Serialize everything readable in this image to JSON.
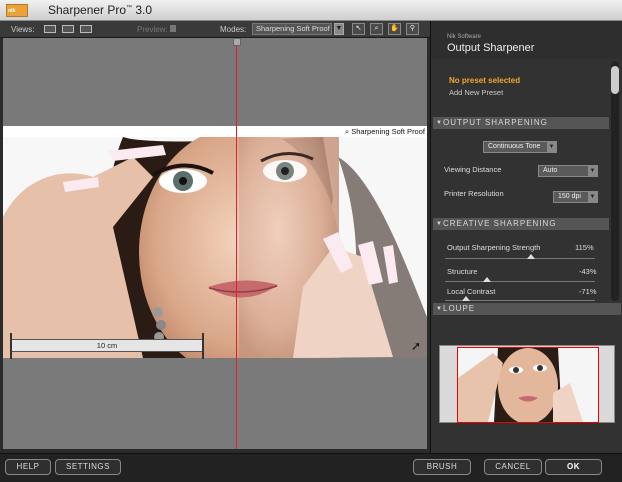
{
  "window": {
    "title": "Sharpener Pro",
    "title_sup": "™",
    "version": " 3.0",
    "logo_text": "nik"
  },
  "toolbar": {
    "views_label": "Views:",
    "preview_label": "Preview:",
    "modes_label": "Modes:",
    "mode_value": "Sharpening Soft Proof",
    "tools": [
      "pointer-tool",
      "zoom-tool",
      "hand-tool",
      "eyedropper-tool"
    ]
  },
  "canvas": {
    "soft_proof_label": "Sharpening Soft Proof",
    "ruler_label": "10 cm"
  },
  "panel": {
    "vendor": "Nik Software",
    "title": "Output Sharpener",
    "preset_status": "No preset selected",
    "add_preset": "Add New Preset",
    "output_section": "OUTPUT SHARPENING",
    "output_type": "Continuous Tone",
    "viewing_distance_label": "Viewing Distance",
    "viewing_distance_value": "Auto",
    "printer_resolution_label": "Printer Resolution",
    "printer_resolution_value": "150 dpi",
    "creative_section": "CREATIVE SHARPENING",
    "sliders": [
      {
        "label": "Output Sharpening Strength",
        "value": "115%",
        "level": 0.57
      },
      {
        "label": "Structure",
        "value": "-43%",
        "level": 0.28
      },
      {
        "label": "Local Contrast",
        "value": "-71%",
        "level": 0.14
      }
    ],
    "loupe_section": "LOUPE"
  },
  "buttons": {
    "help": "HELP",
    "settings": "SETTINGS",
    "brush": "BRUSH",
    "cancel": "CANCEL",
    "ok": "OK"
  },
  "colors": {
    "accent": "#f2a633",
    "split_line": "#e0202a"
  }
}
